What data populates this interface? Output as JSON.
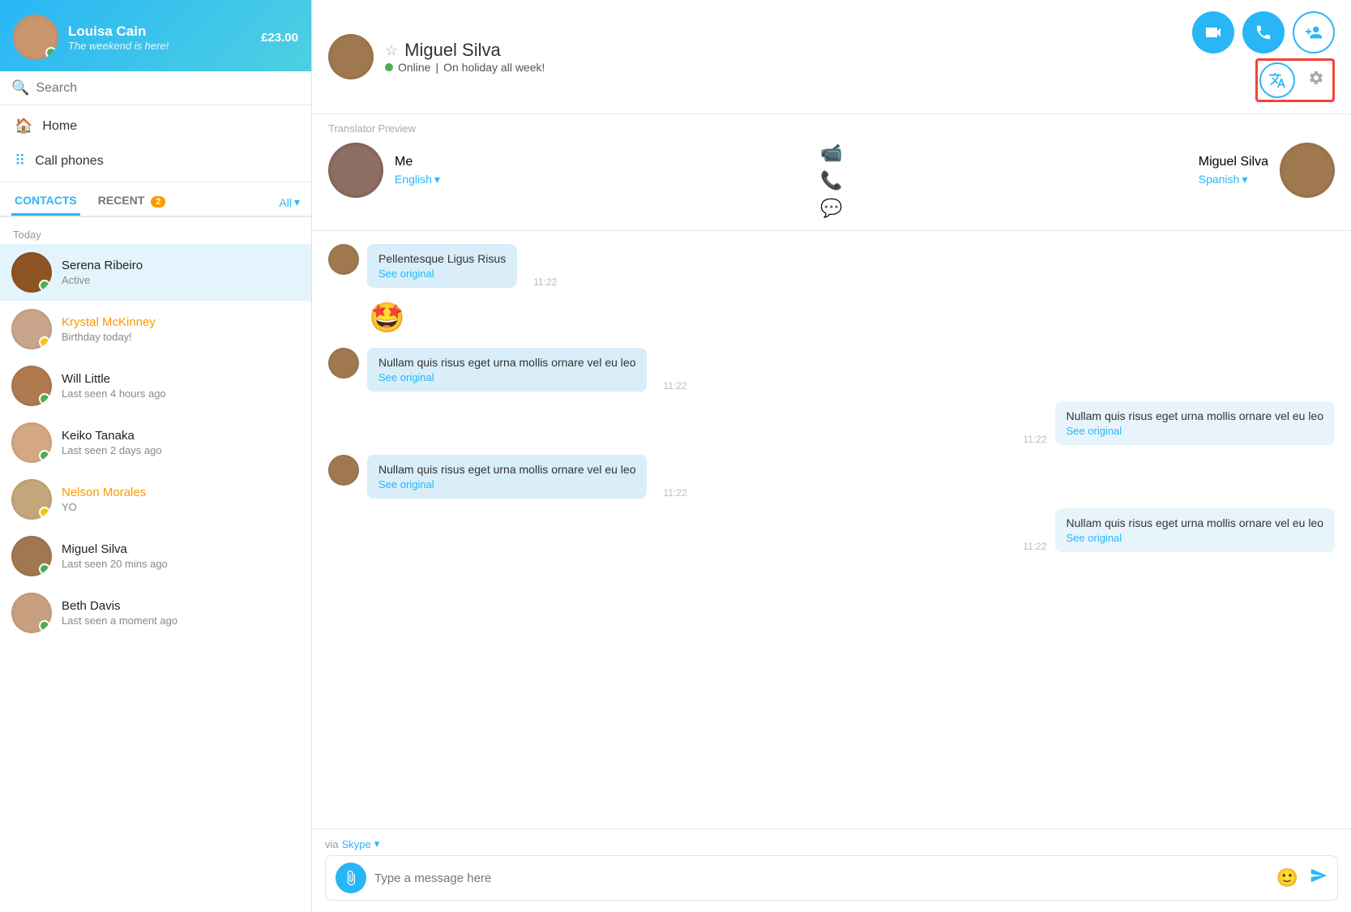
{
  "sidebar": {
    "user": {
      "name": "Louisa Cain",
      "status": "The weekend is here!",
      "credit": "£23.00"
    },
    "search": {
      "placeholder": "Search"
    },
    "nav": [
      {
        "icon": "🏠",
        "label": "Home"
      },
      {
        "icon": "⠿",
        "label": "Call phones"
      }
    ],
    "tabs": [
      {
        "label": "CONTACTS",
        "active": true
      },
      {
        "label": "RECENT",
        "badge": "2"
      }
    ],
    "all_label": "All",
    "section_today": "Today",
    "contacts": [
      {
        "name": "Serena Ribeiro",
        "sub": "Active",
        "status": "online",
        "selected": true
      },
      {
        "name": "Krystal McKinney",
        "sub": "Birthday today!",
        "status": "away",
        "highlight": "orange"
      },
      {
        "name": "Will Little",
        "sub": "Last seen 4 hours ago",
        "status": "online"
      },
      {
        "name": "Keiko Tanaka",
        "sub": "Last seen 2 days ago",
        "status": "online"
      },
      {
        "name": "Nelson Morales",
        "sub": "YO",
        "status": "away",
        "highlight": "orange"
      },
      {
        "name": "Miguel Silva",
        "sub": "Last seen 20 mins ago",
        "status": "online"
      },
      {
        "name": "Beth Davis",
        "sub": "Last seen a moment ago",
        "status": "online"
      }
    ]
  },
  "chat": {
    "contact_name": "Miguel Silva",
    "contact_status": "Online",
    "contact_status_extra": "On holiday all week!",
    "translator_label": "Translator Preview",
    "me_label": "Me",
    "me_lang": "English",
    "contact_lang": "Spanish",
    "buttons": {
      "video": "video-call",
      "phone": "phone-call",
      "add_contact": "add-contact"
    },
    "messages": [
      {
        "side": "left",
        "text": "Pellentesque Ligus Risus",
        "see_original": "See original",
        "time": "11:22"
      },
      {
        "side": "emoji",
        "emoji": "🤩"
      },
      {
        "side": "left",
        "text": "Nullam quis risus eget urna mollis ornare vel eu leo",
        "see_original": "See original",
        "time": "11:22"
      },
      {
        "side": "right",
        "text": "Nullam quis risus eget urna mollis ornare vel eu leo",
        "see_original": "See original",
        "time": "11:22"
      },
      {
        "side": "left",
        "text": "Nullam quis risus eget urna mollis ornare vel eu leo",
        "see_original": "See original",
        "time": "11:22"
      },
      {
        "side": "right",
        "text": "Nullam quis risus eget urna mollis ornare vel eu leo",
        "see_original": "See original",
        "time": "11:22"
      }
    ],
    "via_label": "via",
    "via_name": "Skype",
    "input_placeholder": "Type a message here"
  }
}
